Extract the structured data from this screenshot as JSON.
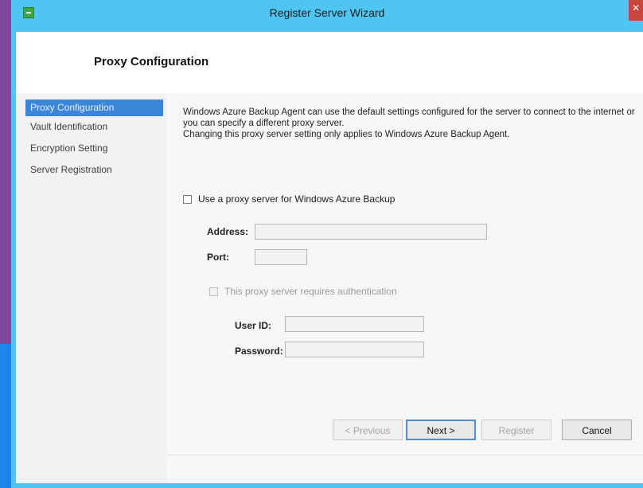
{
  "window": {
    "title": "Register Server Wizard",
    "close_glyph": "✕"
  },
  "header": {
    "title": "Proxy Configuration"
  },
  "nav": {
    "items": [
      {
        "label": "Proxy Configuration",
        "active": true
      },
      {
        "label": "Vault Identification",
        "active": false
      },
      {
        "label": "Encryption Setting",
        "active": false
      },
      {
        "label": "Server Registration",
        "active": false
      }
    ]
  },
  "main": {
    "desc_line1": "Windows Azure Backup Agent can use the default settings configured for the server to connect to the internet or you can specify a different proxy server.",
    "desc_line2": "Changing this proxy server setting only applies to Windows Azure Backup Agent.",
    "use_proxy_label": "Use a proxy server for Windows Azure Backup",
    "use_proxy_checked": false,
    "address_label": "Address:",
    "address_value": "",
    "port_label": "Port:",
    "port_value": "",
    "auth_label": "This proxy server requires authentication",
    "auth_checked": false,
    "userid_label": "User ID:",
    "userid_value": "",
    "password_label": "Password:",
    "password_value": ""
  },
  "footer": {
    "previous_label": "< Previous",
    "next_label": "Next >",
    "register_label": "Register",
    "cancel_label": "Cancel"
  },
  "colors": {
    "accent": "#3b86d6",
    "window_frame": "#4fc6f2",
    "desktop": "#7b4aa0"
  },
  "icons": [
    "app-icon",
    "close-icon"
  ]
}
